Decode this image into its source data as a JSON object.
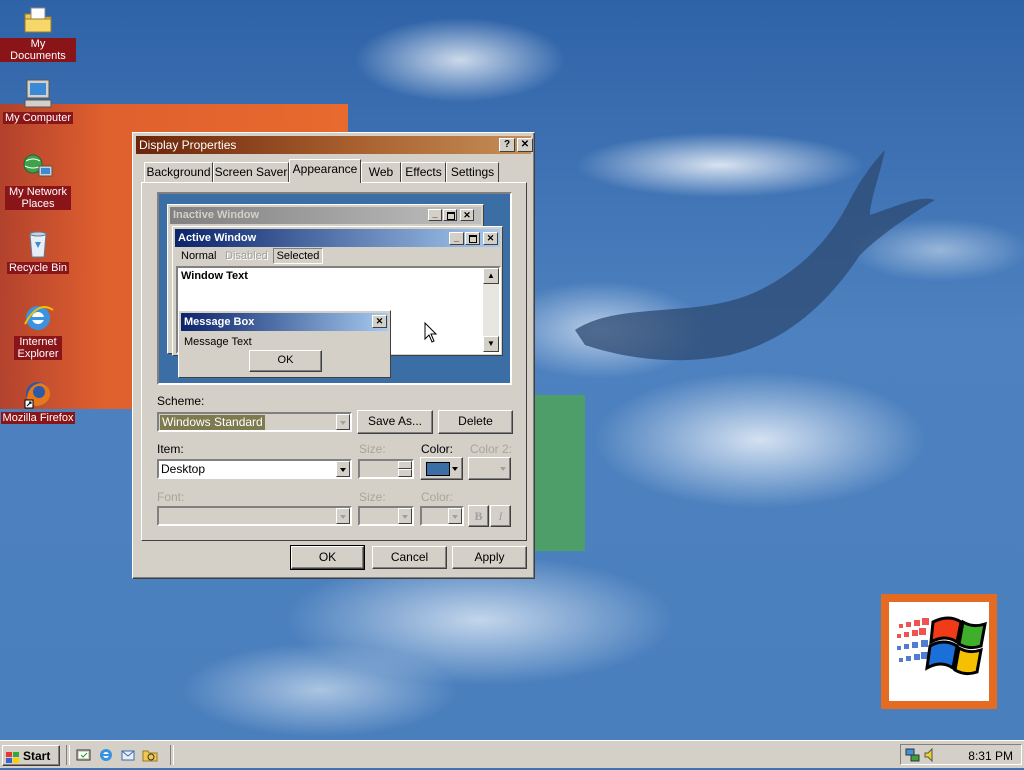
{
  "desktop": {
    "icons": [
      {
        "label": "My Documents",
        "icon": "my-documents-icon"
      },
      {
        "label": "My Computer",
        "icon": "my-computer-icon"
      },
      {
        "label": "My Network Places",
        "icon": "network-places-icon"
      },
      {
        "label": "Recycle Bin",
        "icon": "recycle-bin-icon"
      },
      {
        "label": "Internet Explorer",
        "icon": "internet-explorer-icon"
      },
      {
        "label": "Mozilla Firefox",
        "icon": "firefox-icon"
      }
    ]
  },
  "dialog": {
    "title": "Display Properties",
    "help_glyph": "?",
    "close_glyph": "✕",
    "tabs": [
      {
        "label": "Background"
      },
      {
        "label": "Screen Saver"
      },
      {
        "label": "Appearance"
      },
      {
        "label": "Web"
      },
      {
        "label": "Effects"
      },
      {
        "label": "Settings"
      }
    ],
    "active_tab": "Appearance",
    "preview": {
      "inactive_title": "Inactive Window",
      "active_title": "Active Window",
      "menu": {
        "normal": "Normal",
        "disabled": "Disabled",
        "selected": "Selected"
      },
      "window_text": "Window Text",
      "message_box_title": "Message Box",
      "message_text": "Message Text",
      "ok_label": "OK"
    },
    "scheme": {
      "label": "Scheme:",
      "value": "Windows Standard",
      "save_as": "Save As...",
      "delete": "Delete"
    },
    "item": {
      "label": "Item:",
      "value": "Desktop",
      "size_label": "Size:",
      "color_label": "Color:",
      "color2_label": "Color 2:",
      "color_value": "#3a6ea5"
    },
    "font": {
      "label": "Font:",
      "size_label": "Size:",
      "color_label": "Color:",
      "bold": "B",
      "italic": "I"
    },
    "buttons": {
      "ok": "OK",
      "cancel": "Cancel",
      "apply": "Apply"
    }
  },
  "taskbar": {
    "start_label": "Start",
    "quick_launch": [
      "show-desktop-icon",
      "internet-explorer-icon",
      "outlook-express-icon",
      "windows-explorer-icon"
    ],
    "tray_icons": [
      "network-tray-icon",
      "volume-tray-icon"
    ],
    "clock": "8:31 PM"
  },
  "colors": {
    "title_start": "#6a240a",
    "title_end": "#c68f57",
    "active_title_start": "#0a246a",
    "active_title_end": "#a6caf0",
    "desktop_blue": "#3a6ea5",
    "icon_label_bg": "#8a1519"
  }
}
